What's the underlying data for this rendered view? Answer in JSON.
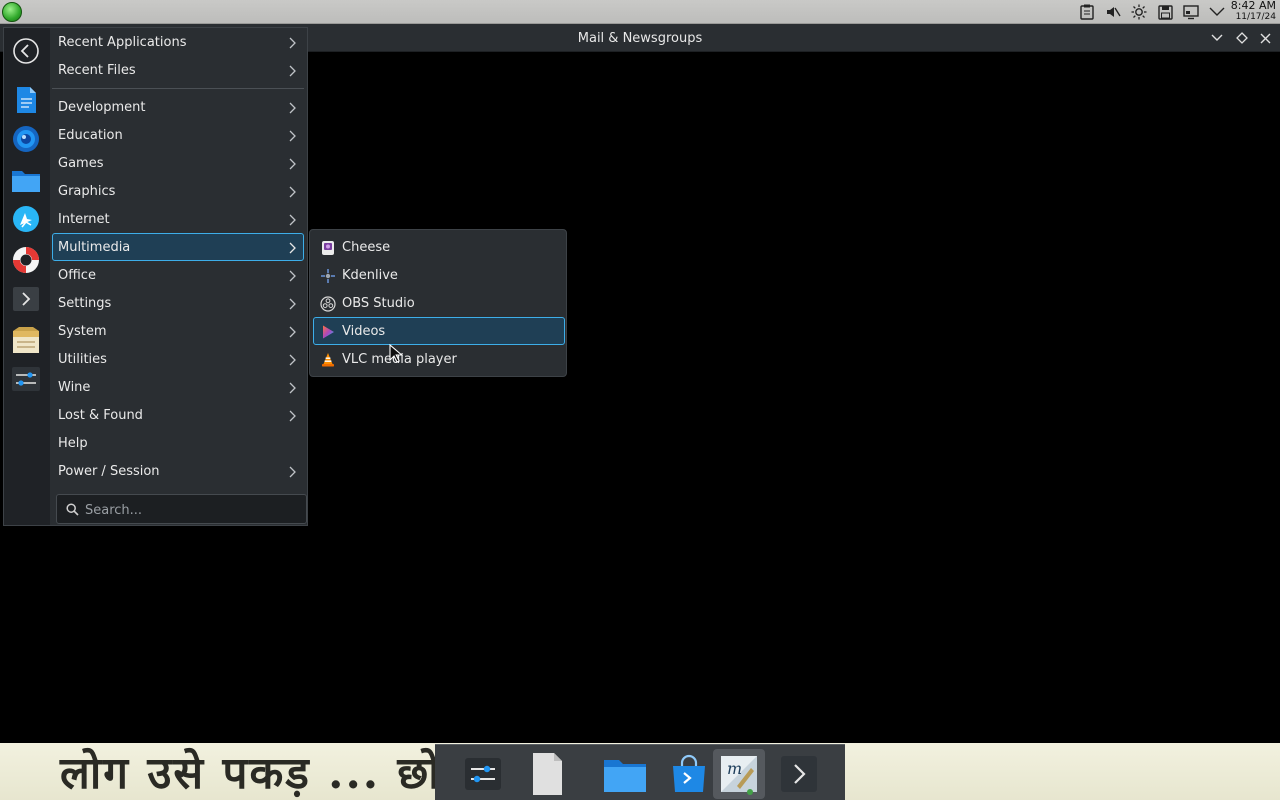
{
  "window": {
    "title": "Mail & Newsgroups"
  },
  "clock": {
    "time": "8:42 AM",
    "date": "11/17/24"
  },
  "tray": [
    "clipboard-icon",
    "volume-muted-icon",
    "brightness-icon",
    "save-icon",
    "display-icon",
    "chevron-down-icon"
  ],
  "titlebar_buttons": [
    "minimize-icon",
    "maximize-icon",
    "close-icon"
  ],
  "sidebar_favorites": [
    "back-icon",
    "text-editor-icon",
    "system-settings-icon",
    "file-manager-icon",
    "discover-icon",
    "help-center-icon",
    "terminal-icon",
    "archive-icon",
    "settings-sliders-icon"
  ],
  "menu": {
    "categories": [
      {
        "label": "Recent Applications",
        "arrow": true
      },
      {
        "label": "Recent Files",
        "arrow": true
      },
      {
        "label": "Development",
        "arrow": true
      },
      {
        "label": "Education",
        "arrow": true
      },
      {
        "label": "Games",
        "arrow": true
      },
      {
        "label": "Graphics",
        "arrow": true
      },
      {
        "label": "Internet",
        "arrow": true
      },
      {
        "label": "Multimedia",
        "arrow": true,
        "active": true
      },
      {
        "label": "Office",
        "arrow": true
      },
      {
        "label": "Settings",
        "arrow": true
      },
      {
        "label": "System",
        "arrow": true
      },
      {
        "label": "Utilities",
        "arrow": true
      },
      {
        "label": "Wine",
        "arrow": true
      },
      {
        "label": "Lost & Found",
        "arrow": true
      },
      {
        "label": "Help",
        "arrow": false
      },
      {
        "label": "Power / Session",
        "arrow": true
      }
    ],
    "search_placeholder": "Search..."
  },
  "submenu": {
    "items": [
      {
        "label": "Cheese",
        "icon": "cheese-icon"
      },
      {
        "label": "Kdenlive",
        "icon": "kdenlive-icon"
      },
      {
        "label": "OBS Studio",
        "icon": "obs-icon"
      },
      {
        "label": "Videos",
        "icon": "videos-play-icon",
        "active": true
      },
      {
        "label": "VLC media player",
        "icon": "vlc-cone-icon"
      }
    ]
  },
  "wallpaper_text": "लोग उसे पकड़ ... छोड़ आते हैं।",
  "dock": [
    "settings-sliders-icon",
    "document-icon",
    "file-manager-icon",
    "store-icon",
    "mail-app-icon",
    "next-arrow-icon"
  ],
  "colors": {
    "accent": "#3daee9",
    "panel": "#2a2e32",
    "highlight": "#1f3f55"
  }
}
